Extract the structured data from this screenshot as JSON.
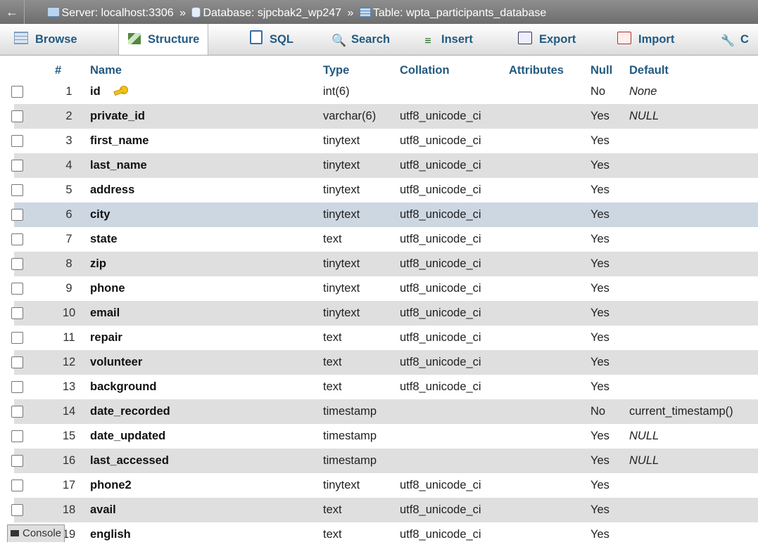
{
  "breadcrumb": {
    "back": "←",
    "server": "Server: localhost:3306",
    "sep": "»",
    "database": "Database: sjpcbak2_wp247",
    "table": "Table: wpta_participants_database"
  },
  "tabs": [
    {
      "label": "Browse",
      "icon": "browse-icon"
    },
    {
      "label": "Structure",
      "icon": "structure-icon",
      "active": true
    },
    {
      "label": "SQL",
      "icon": "sql-icon"
    },
    {
      "label": "Search",
      "icon": "search-icon"
    },
    {
      "label": "Insert",
      "icon": "insert-icon"
    },
    {
      "label": "Export",
      "icon": "export-icon"
    },
    {
      "label": "Import",
      "icon": "import-icon"
    },
    {
      "label": "C",
      "icon": "wrench-icon"
    }
  ],
  "columns": {
    "num": "#",
    "name": "Name",
    "type": "Type",
    "collation": "Collation",
    "attributes": "Attributes",
    "null": "Null",
    "default": "Default"
  },
  "rows": [
    {
      "num": "1",
      "name": "id",
      "type": "int(6)",
      "collation": "",
      "null": "No",
      "default": "None",
      "primary_key": true
    },
    {
      "num": "2",
      "name": "private_id",
      "type": "varchar(6)",
      "collation": "utf8_unicode_ci",
      "null": "Yes",
      "default": "NULL"
    },
    {
      "num": "3",
      "name": "first_name",
      "type": "tinytext",
      "collation": "utf8_unicode_ci",
      "null": "Yes",
      "default": ""
    },
    {
      "num": "4",
      "name": "last_name",
      "type": "tinytext",
      "collation": "utf8_unicode_ci",
      "null": "Yes",
      "default": ""
    },
    {
      "num": "5",
      "name": "address",
      "type": "tinytext",
      "collation": "utf8_unicode_ci",
      "null": "Yes",
      "default": ""
    },
    {
      "num": "6",
      "name": "city",
      "type": "tinytext",
      "collation": "utf8_unicode_ci",
      "null": "Yes",
      "default": "",
      "highlighted": true
    },
    {
      "num": "7",
      "name": "state",
      "type": "text",
      "collation": "utf8_unicode_ci",
      "null": "Yes",
      "default": ""
    },
    {
      "num": "8",
      "name": "zip",
      "type": "tinytext",
      "collation": "utf8_unicode_ci",
      "null": "Yes",
      "default": ""
    },
    {
      "num": "9",
      "name": "phone",
      "type": "tinytext",
      "collation": "utf8_unicode_ci",
      "null": "Yes",
      "default": ""
    },
    {
      "num": "10",
      "name": "email",
      "type": "tinytext",
      "collation": "utf8_unicode_ci",
      "null": "Yes",
      "default": ""
    },
    {
      "num": "11",
      "name": "repair",
      "type": "text",
      "collation": "utf8_unicode_ci",
      "null": "Yes",
      "default": ""
    },
    {
      "num": "12",
      "name": "volunteer",
      "type": "text",
      "collation": "utf8_unicode_ci",
      "null": "Yes",
      "default": ""
    },
    {
      "num": "13",
      "name": "background",
      "type": "text",
      "collation": "utf8_unicode_ci",
      "null": "Yes",
      "default": ""
    },
    {
      "num": "14",
      "name": "date_recorded",
      "type": "timestamp",
      "collation": "",
      "null": "No",
      "default": "current_timestamp()"
    },
    {
      "num": "15",
      "name": "date_updated",
      "type": "timestamp",
      "collation": "",
      "null": "Yes",
      "default": "NULL"
    },
    {
      "num": "16",
      "name": "last_accessed",
      "type": "timestamp",
      "collation": "",
      "null": "Yes",
      "default": "NULL"
    },
    {
      "num": "17",
      "name": "phone2",
      "type": "tinytext",
      "collation": "utf8_unicode_ci",
      "null": "Yes",
      "default": ""
    },
    {
      "num": "18",
      "name": "avail",
      "type": "text",
      "collation": "utf8_unicode_ci",
      "null": "Yes",
      "default": ""
    },
    {
      "num": "19",
      "name": "english",
      "type": "text",
      "collation": "utf8_unicode_ci",
      "null": "Yes",
      "default": ""
    }
  ],
  "console": {
    "label": "Console",
    "icon": "console-icon"
  },
  "colors": {
    "link": "#235a81",
    "row_alt": "#dfdfdf",
    "row_hover": "#ccd7e2"
  }
}
